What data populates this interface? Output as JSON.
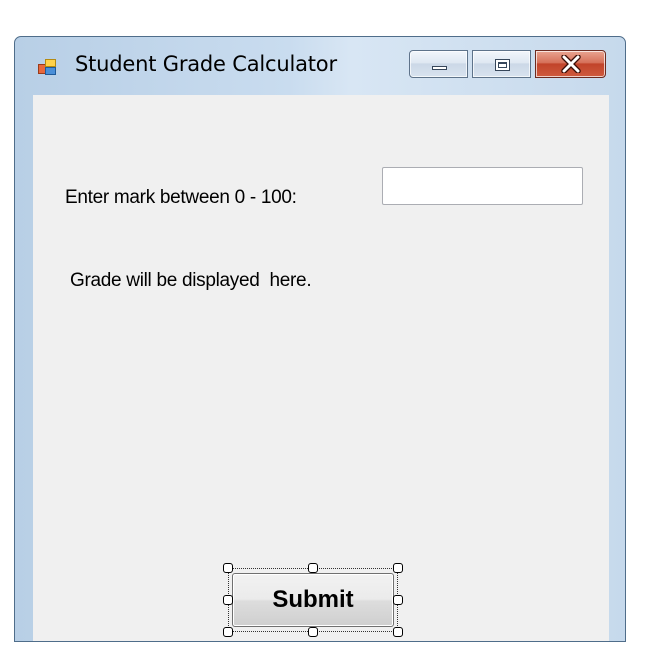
{
  "window": {
    "title": "Student Grade Calculator",
    "app_icon": "windows-form-icon",
    "caption_buttons": [
      "minimize-icon",
      "maximize-icon",
      "close-icon"
    ],
    "close_color": "#c1432a",
    "frame_color": "#c6d9ec"
  },
  "form": {
    "mark_label": "Enter mark between 0 - 100:",
    "mark_input_value": "",
    "grade_label": "Grade will be displayed  here.",
    "submit_label": "Submit",
    "background": "#f0f0f0"
  }
}
